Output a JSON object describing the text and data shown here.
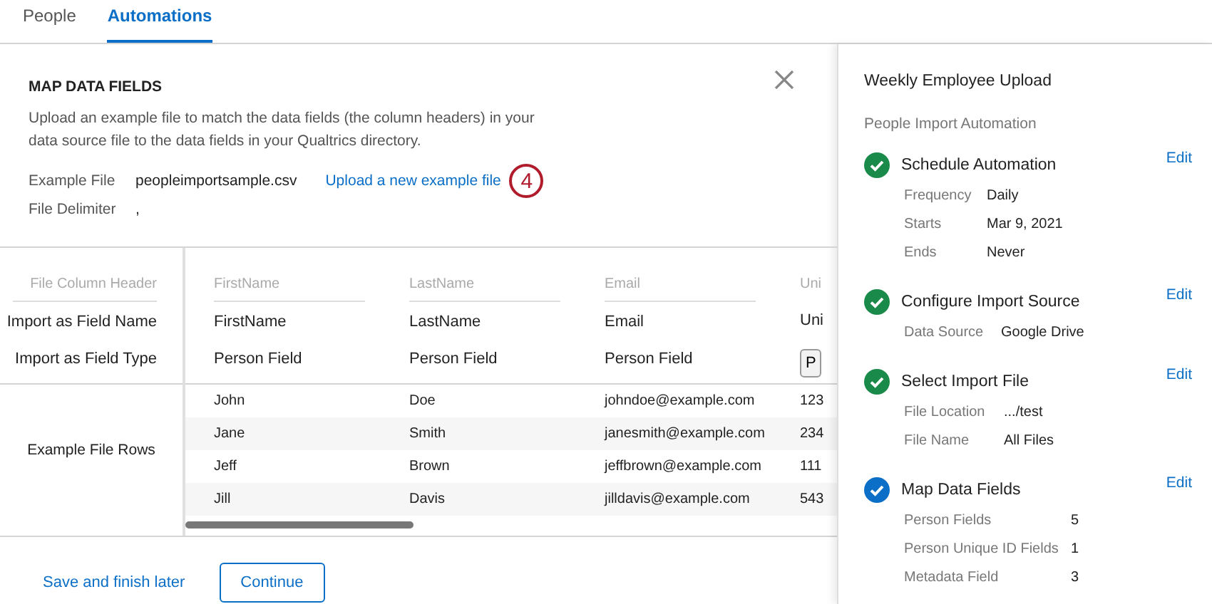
{
  "tabs": [
    {
      "label": "People",
      "selected": false
    },
    {
      "label": "Automations",
      "selected": true
    }
  ],
  "dialog": {
    "title": "MAP DATA FIELDS",
    "description": "Upload an example file to match the data fields (the column headers) in your data source file to the data fields in your Qualtrics directory.",
    "fields": [
      {
        "label": "Example File",
        "value": "peopleimportsample.csv"
      },
      {
        "label": "File Delimiter",
        "value": ","
      }
    ],
    "upload_link": "Upload a new example file",
    "step_badge": "4"
  },
  "mapping": {
    "row_labels": [
      "File Column Header",
      "Import as Field Name",
      "Import as Field Type"
    ],
    "rows_label": "Example File Rows",
    "columns": [
      {
        "header": "FirstName",
        "field_name": "FirstName",
        "field_type": "Person Field",
        "kind": "text"
      },
      {
        "header": "LastName",
        "field_name": "LastName",
        "field_type": "Person Field",
        "kind": "text"
      },
      {
        "header": "Email",
        "field_name": "Email",
        "field_type": "Person Field",
        "kind": "text"
      },
      {
        "header": "Uni",
        "field_name": "Uni",
        "field_type": "P",
        "kind": "dropdown"
      }
    ],
    "rows": [
      [
        "John",
        "Doe",
        "johndoe@example.com",
        "123"
      ],
      [
        "Jane",
        "Smith",
        "janesmith@example.com",
        "234"
      ],
      [
        "Jeff",
        "Brown",
        "jeffbrown@example.com",
        "111"
      ],
      [
        "Jill",
        "Davis",
        "jilldavis@example.com",
        "543"
      ]
    ]
  },
  "footer": {
    "save_link": "Save and finish later",
    "continue_button": "Continue"
  },
  "sidebar": {
    "title": "Weekly Employee Upload",
    "subtitle": "People Import Automation",
    "steps": [
      {
        "title": "Schedule Automation",
        "current": false,
        "edit": "Edit",
        "details": [
          {
            "label": "Frequency",
            "value": "Daily"
          },
          {
            "label": "Starts",
            "value": "Mar 9, 2021"
          },
          {
            "label": "Ends",
            "value": "Never"
          }
        ]
      },
      {
        "title": "Configure Import Source",
        "current": false,
        "edit": "Edit",
        "details": [
          {
            "label": "Data Source",
            "value": "Google Drive"
          }
        ]
      },
      {
        "title": "Select Import File",
        "current": false,
        "edit": "Edit",
        "details": [
          {
            "label": "File Location",
            "value": ".../test"
          },
          {
            "label": "File Name",
            "value": "All Files"
          }
        ]
      },
      {
        "title": "Map Data Fields",
        "current": true,
        "edit": "Edit",
        "details": [
          {
            "label": "Person Fields",
            "value": "5"
          },
          {
            "label": "Person Unique ID Fields",
            "value": "1"
          },
          {
            "label": "Metadata Field",
            "value": "3"
          }
        ]
      }
    ]
  }
}
